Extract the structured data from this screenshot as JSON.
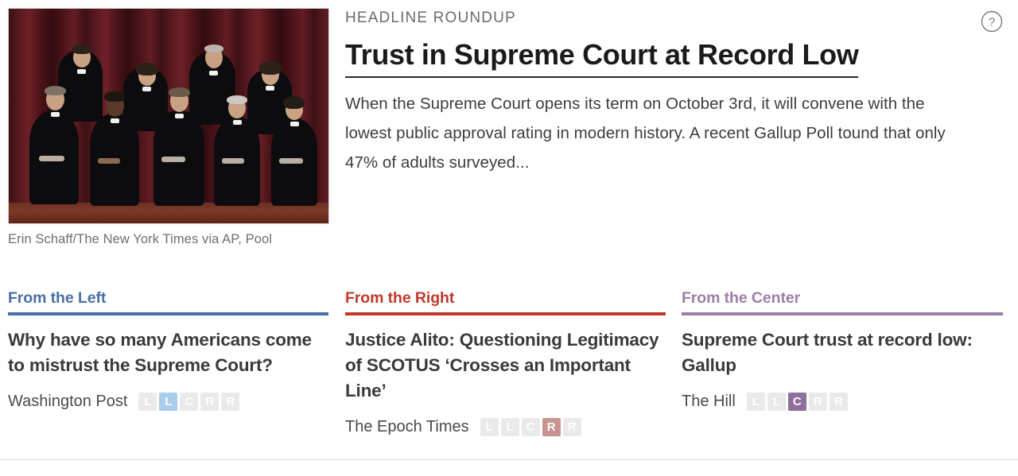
{
  "article": {
    "kicker": "HEADLINE ROUNDUP",
    "headline": "Trust in Supreme Court at Record Low",
    "summary": "When the Supreme Court opens its term on October 3rd, it will convene with the lowest public approval rating in modern history. A recent Gallup Poll tound that only 47% of adults surveyed...",
    "help_icon": "question-mark-circle-icon"
  },
  "hero": {
    "alt": "Supreme Court justices group portrait in black robes before red curtain",
    "credit": "Erin Schaff/The New York Times via AP, Pool"
  },
  "columns": [
    {
      "heading": "From the Left",
      "accent": "#4a6fa5",
      "title": "Why have so many Americans come to mistrust the Supreme Court?",
      "source": "Washington Post",
      "meter": {
        "labels": [
          "L",
          "L",
          "C",
          "R",
          "R"
        ],
        "active_index": 1,
        "active_class": "on-left"
      }
    },
    {
      "heading": "From the Right",
      "accent": "#c0392b",
      "title": "Justice Alito: Questioning Legitimacy of SCOTUS ‘Crosses an Important Line’",
      "source": "The Epoch Times",
      "meter": {
        "labels": [
          "L",
          "L",
          "C",
          "R",
          "R"
        ],
        "active_index": 3,
        "active_class": "on-right"
      }
    },
    {
      "heading": "From the Center",
      "accent": "#9b7fa8",
      "title": "Supreme Court trust at record low: Gallup",
      "source": "The Hill",
      "meter": {
        "labels": [
          "L",
          "L",
          "C",
          "R",
          "R"
        ],
        "active_index": 2,
        "active_class": "on-center"
      }
    }
  ]
}
